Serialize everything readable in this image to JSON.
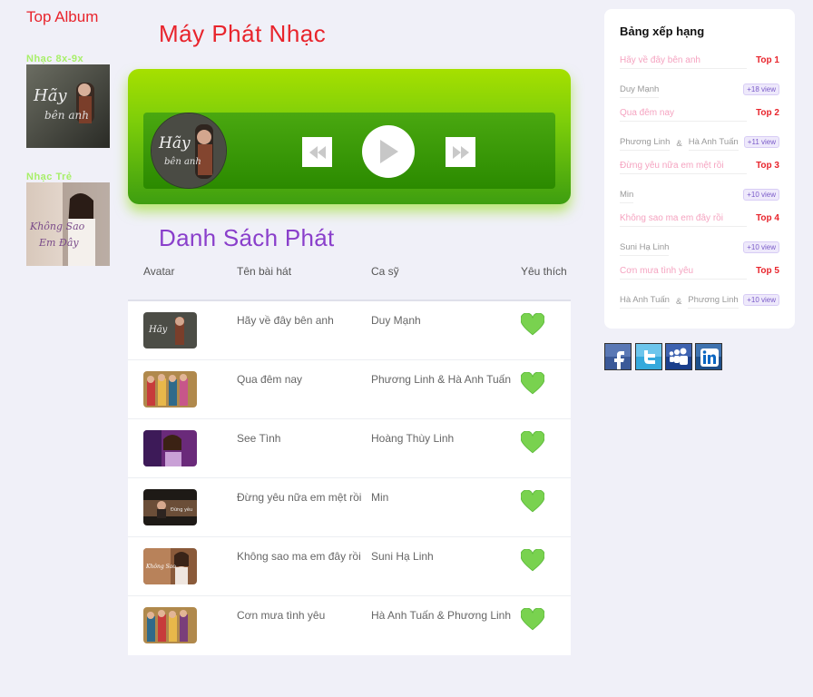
{
  "sidebar": {
    "title": "Top Album",
    "categories": [
      {
        "label": "Nhạc 8x-9x"
      },
      {
        "label": "Nhạc Trẻ"
      }
    ]
  },
  "player": {
    "title": "Máy Phát Nhạc",
    "disc_text": "Hãy về đây bên anh"
  },
  "playlist": {
    "title": "Danh Sách Phát",
    "headers": {
      "avatar": "Avatar",
      "song": "Tên bài hát",
      "artist": "Ca sỹ",
      "like": "Yêu thích"
    },
    "rows": [
      {
        "song": "Hãy về đây bên anh",
        "artist": "Duy Mạnh"
      },
      {
        "song": "Qua đêm nay",
        "artist": "Phương Linh & Hà Anh Tuấn"
      },
      {
        "song": "See Tình",
        "artist": "Hoàng Thùy Linh"
      },
      {
        "song": "Đừng yêu nữa em mệt rồi",
        "artist": "Min"
      },
      {
        "song": "Không sao ma em đây rồi",
        "artist": "Suni Hạ Linh"
      },
      {
        "song": "Cơn mưa tình yêu",
        "artist": "Hà Anh Tuấn & Phương Linh"
      }
    ]
  },
  "ranking": {
    "title": "Bảng xếp hạng",
    "items": [
      {
        "song": "Hãy về đây bên anh",
        "rank": "Top 1",
        "artists": [
          "Duy Mạnh"
        ],
        "views": "+18 view"
      },
      {
        "song": "Qua đêm nay",
        "rank": "Top 2",
        "artists": [
          "Phương Linh",
          "Hà Anh Tuấn"
        ],
        "views": "+11 view"
      },
      {
        "song": "Đừng yêu nữa em mệt rồi",
        "rank": "Top 3",
        "artists": [
          "Min"
        ],
        "views": "+10 view"
      },
      {
        "song": "Không sao ma em đây rồi",
        "rank": "Top 4",
        "artists": [
          "Suni Hạ Linh"
        ],
        "views": "+10 view"
      },
      {
        "song": "Cơn mưa tình yêu",
        "rank": "Top 5",
        "artists": [
          "Hà Anh Tuấn",
          "Phương Linh"
        ],
        "views": "+10 view"
      }
    ],
    "separator": "&"
  },
  "social": [
    {
      "icon": "facebook-icon",
      "color": "#3b5998"
    },
    {
      "icon": "twitter-icon",
      "color": "#35a9dc"
    },
    {
      "icon": "myspace-icon",
      "color": "#1a3f8c"
    },
    {
      "icon": "linkedin-icon",
      "color": "#0a66c2"
    }
  ],
  "colors": {
    "accent_red": "#e8242c",
    "accent_purple": "#8a3fcb",
    "player_green": "#7ccd0a",
    "heart_green": "#79d24f"
  }
}
